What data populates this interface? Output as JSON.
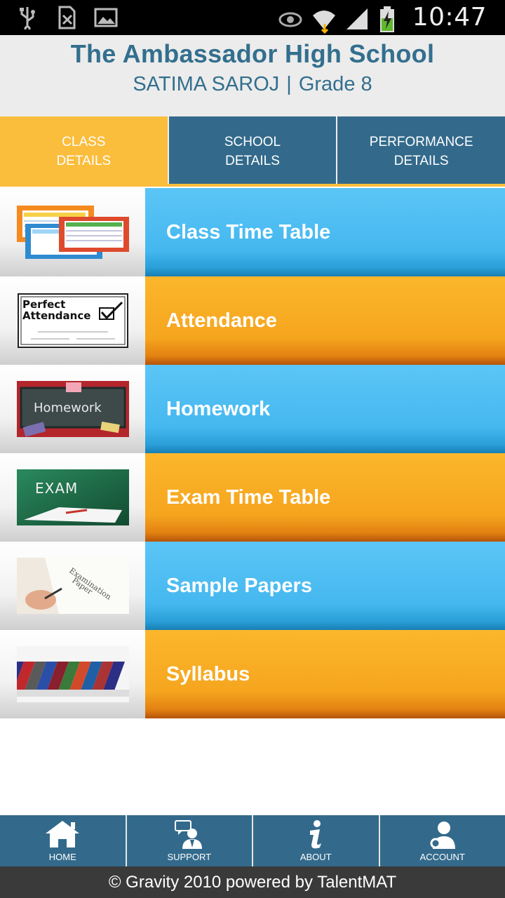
{
  "status_bar": {
    "time": "10:47",
    "left_icons": [
      "usb-icon",
      "sim-missing-icon",
      "image-icon"
    ],
    "right_icons": [
      "eye-icon",
      "wifi-icon",
      "signal-icon",
      "battery-charging-icon"
    ]
  },
  "header": {
    "school_name": "The Ambassador High School",
    "student_name": "SATIMA SAROJ",
    "separator": "|",
    "grade": "Grade 8"
  },
  "tabs": [
    {
      "line1": "CLASS",
      "line2": "DETAILS",
      "active": true
    },
    {
      "line1": "SCHOOL",
      "line2": "DETAILS",
      "active": false
    },
    {
      "line1": "PERFORMANCE",
      "line2": "DETAILS",
      "active": false
    }
  ],
  "menu": [
    {
      "label": "Class Time Table",
      "color": "blue",
      "thumb_text": ""
    },
    {
      "label": "Attendance",
      "color": "orange",
      "thumb_text": "Perfect Attendance"
    },
    {
      "label": "Homework",
      "color": "blue",
      "thumb_text": "Homework"
    },
    {
      "label": "Exam Time Table",
      "color": "orange",
      "thumb_text": "EXAM"
    },
    {
      "label": "Sample Papers",
      "color": "blue",
      "thumb_text": "Examination Paper"
    },
    {
      "label": "Syllabus",
      "color": "orange",
      "thumb_text": ""
    }
  ],
  "bottom_nav": [
    {
      "label": "HOME",
      "icon": "home-icon"
    },
    {
      "label": "SUPPORT",
      "icon": "support-icon"
    },
    {
      "label": "ABOUT",
      "icon": "info-icon"
    },
    {
      "label": "ACCOUNT",
      "icon": "account-icon"
    }
  ],
  "footer": {
    "text": "© Gravity 2010 powered by TalentMAT"
  },
  "colors": {
    "primary": "#336a8b",
    "accent": "#fbbd3c",
    "menu_blue": "#45b8ef",
    "menu_orange": "#f5a51e",
    "footer_bg": "#3a3a3a"
  }
}
